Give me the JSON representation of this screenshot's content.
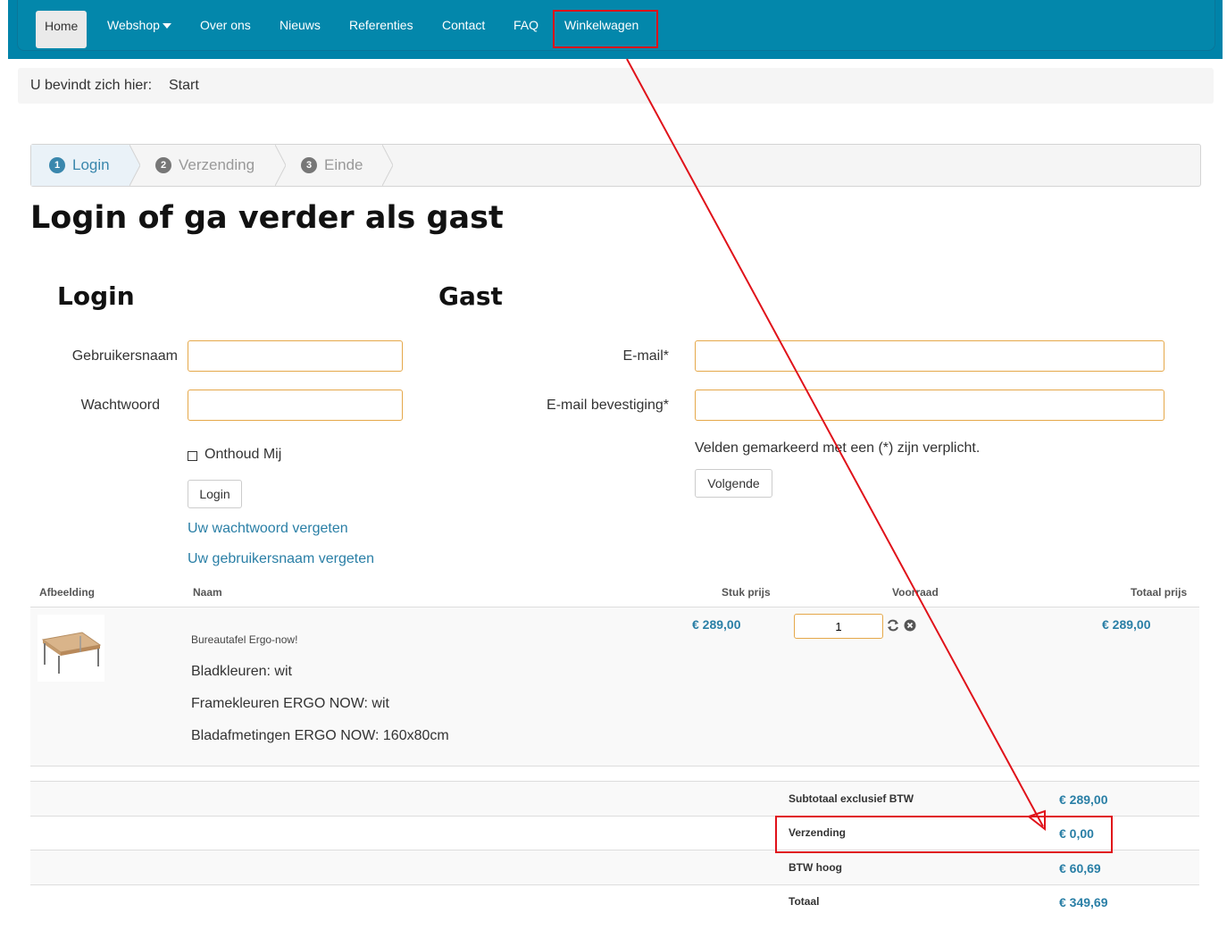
{
  "nav": {
    "items": [
      "Home",
      "Webshop",
      "Over ons",
      "Nieuws",
      "Referenties",
      "Contact",
      "FAQ",
      "Winkelwagen"
    ]
  },
  "breadcrumb": {
    "prefix": "U bevindt zich hier:",
    "current": "Start"
  },
  "steps": [
    {
      "num": "1",
      "label": "Login"
    },
    {
      "num": "2",
      "label": "Verzending"
    },
    {
      "num": "3",
      "label": "Einde"
    }
  ],
  "page_title": "Login of ga verder als gast",
  "login": {
    "heading": "Login",
    "username_label": "Gebruikersnaam",
    "username_value": "",
    "password_label": "Wachtwoord",
    "password_value": "",
    "remember_label": "Onthoud Mij",
    "submit_label": "Login",
    "forgot_password": "Uw wachtwoord vergeten",
    "forgot_username": "Uw gebruikersnaam vergeten"
  },
  "guest": {
    "heading": "Gast",
    "email_label": "E-mail*",
    "email_value": "",
    "email_confirm_label": "E-mail bevestiging*",
    "email_confirm_value": "",
    "required_note": "Velden gemarkeerd met een (*) zijn verplicht.",
    "next_label": "Volgende"
  },
  "cart": {
    "headers": {
      "image": "Afbeelding",
      "name": "Naam",
      "unit_price": "Stuk prijs",
      "stock": "Voorraad",
      "total_price": "Totaal prijs"
    },
    "item": {
      "name": "Bureautafel Ergo-now!",
      "attributes": [
        "Bladkleuren: wit",
        "Framekleuren ERGO NOW: wit",
        "Bladafmetingen ERGO NOW: 160x80cm"
      ],
      "unit_price": "€ 289,00",
      "quantity": "1",
      "total_price": "€ 289,00"
    },
    "summary": [
      {
        "label": "Subtotaal exclusief BTW",
        "value": "€ 289,00"
      },
      {
        "label": "Verzending",
        "value": "€ 0,00"
      },
      {
        "label": "BTW hoog",
        "value": "€ 60,69"
      },
      {
        "label": "Totaal",
        "value": "€ 349,69"
      }
    ]
  },
  "colors": {
    "nav_bg": "#0083a9",
    "link": "#2a7fa6",
    "input_border": "#e5a84a",
    "annotation": "#e0121a"
  },
  "icons": [
    "caret-down-icon",
    "refresh-icon",
    "remove-icon",
    "checkbox-icon",
    "product-image",
    "annotation-arrow"
  ]
}
